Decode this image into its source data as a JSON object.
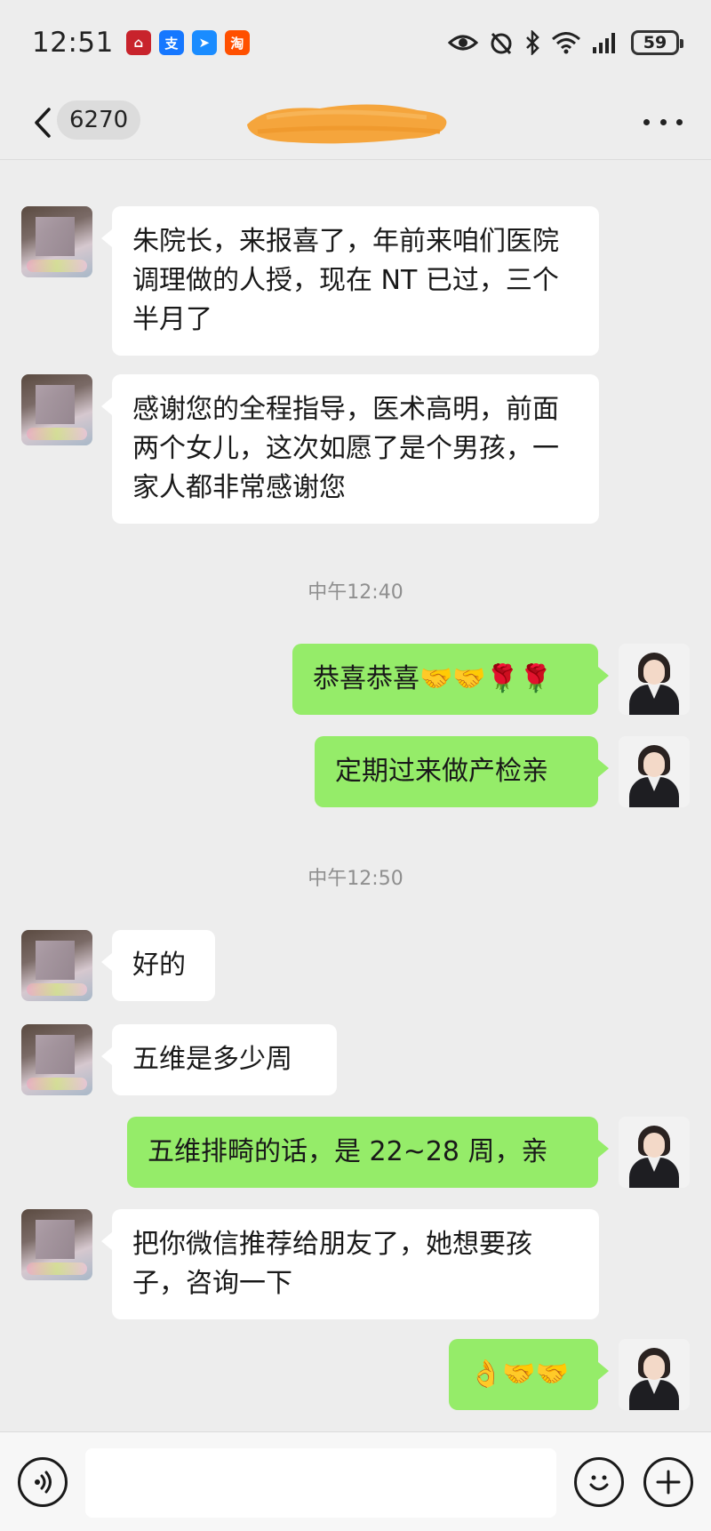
{
  "status_bar": {
    "time": "12:51",
    "battery": "59",
    "notification_icons": [
      {
        "name": "app-house-icon",
        "color": "#c8232c",
        "glyph": "⌂"
      },
      {
        "name": "alipay-icon",
        "color": "#1677ff",
        "glyph": "支"
      },
      {
        "name": "app-arrow-icon",
        "color": "#1a8cff",
        "glyph": "➤"
      },
      {
        "name": "taobao-icon",
        "color": "#ff5000",
        "glyph": "淘"
      }
    ]
  },
  "header": {
    "unread_count": "6270"
  },
  "messages": [
    {
      "side": "left",
      "text": "朱院长，来报喜了，年前来咱们医院调理做的人授，现在 NT 已过，三个半月了"
    },
    {
      "side": "left",
      "text": "感谢您的全程指导，医术高明，前面两个女儿，这次如愿了是个男孩，一家人都非常感谢您"
    },
    {
      "type": "time",
      "text": "中午12:40"
    },
    {
      "side": "right",
      "text": "恭喜恭喜🤝🤝🌹🌹"
    },
    {
      "side": "right",
      "text": "定期过来做产检亲"
    },
    {
      "type": "time",
      "text": "中午12:50"
    },
    {
      "side": "left",
      "text": "好的"
    },
    {
      "side": "left",
      "text": "五维是多少周"
    },
    {
      "side": "right",
      "text": "五维排畸的话，是 22~28 周，亲"
    },
    {
      "side": "left",
      "text": "把你微信推荐给朋友了，她想要孩子，咨询一下"
    },
    {
      "side": "right",
      "text": "👌🤝🤝"
    }
  ],
  "colors": {
    "background": "#ededed",
    "bubble_self": "#95ec69",
    "bubble_other": "#ffffff",
    "redaction": "#f5a53c"
  }
}
